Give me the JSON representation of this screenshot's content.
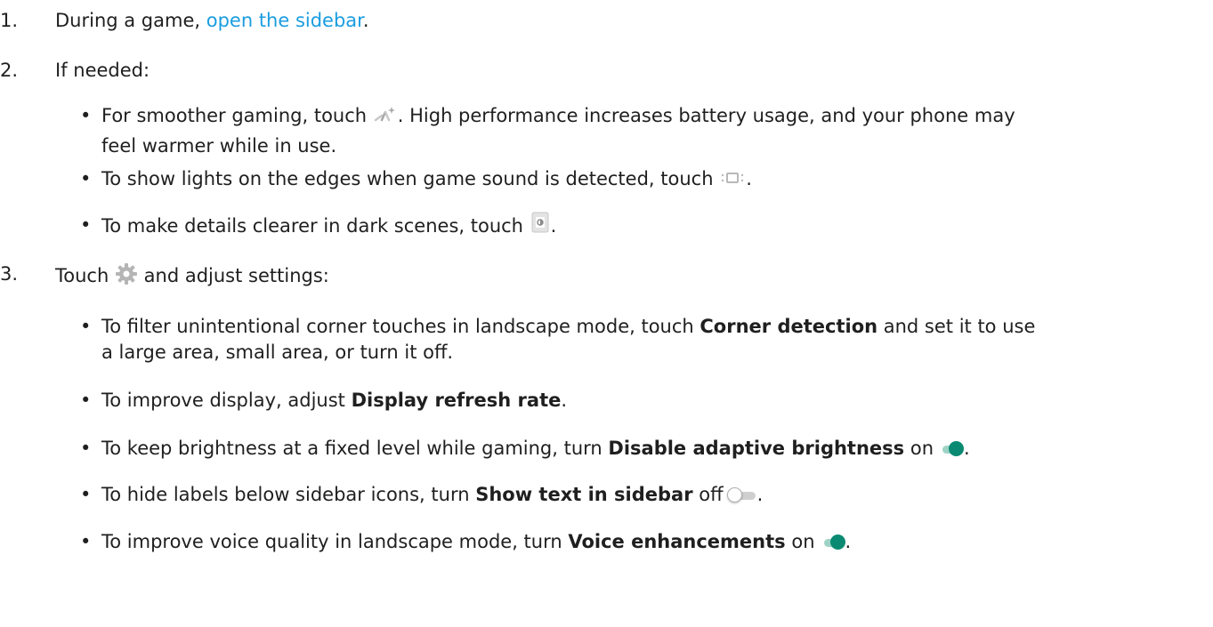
{
  "steps": [
    {
      "number": "1.",
      "prefix": "During a game, ",
      "link": "open the sidebar",
      "suffix": "."
    },
    {
      "number": "2.",
      "text": "If needed:"
    },
    {
      "number": "3.",
      "prefix": "Touch",
      "suffix": "and adjust settings:",
      "icon": "gear-icon"
    }
  ],
  "if_needed": [
    {
      "line1_prefix": "For smoother gaming, touch ",
      "icon": "performance-icon",
      "line1_suffix": ". High performance increases battery usage, and your phone may",
      "line2": "feel warmer while in use."
    },
    {
      "prefix": "To show lights on the edges when game sound is detected, touch ",
      "icon": "edge-lights-icon",
      "suffix": "."
    },
    {
      "prefix": "To make details clearer in dark scenes, touch ",
      "icon": "dark-enhance-icon",
      "suffix": "."
    }
  ],
  "settings": [
    {
      "prefix": "To filter unintentional corner touches in landscape mode, touch ",
      "bold": "Corner detection",
      "suffix": " and set it to use",
      "line2": "a large area, small area, or turn it off."
    },
    {
      "prefix": "To improve display, adjust ",
      "bold": "Display refresh rate",
      "suffix": "."
    },
    {
      "prefix": "To keep brightness at a fixed level while gaming, turn ",
      "bold": "Disable adaptive brightness",
      "suffix": " on",
      "toggle": "on"
    },
    {
      "prefix": "To hide labels below sidebar icons, turn ",
      "bold": "Show text in sidebar",
      "suffix": " off",
      "toggle": "off"
    },
    {
      "prefix": "To improve voice quality in landscape mode, turn ",
      "bold": "Voice enhancements",
      "suffix": " on",
      "toggle": "on"
    }
  ],
  "bullet": "•",
  "period": ".",
  "colors": {
    "link": "#1a9de0",
    "toggle_on": "#0a8a72",
    "toggle_on_track": "#9ed3c5",
    "toggle_off_track": "#cfcfcf"
  }
}
